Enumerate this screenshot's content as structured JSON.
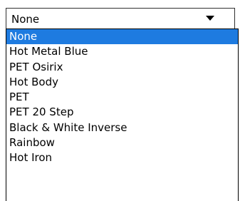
{
  "combo": {
    "selected_value": "None"
  },
  "dropdown": {
    "options": [
      {
        "label": "None",
        "selected": true
      },
      {
        "label": "Hot Metal Blue",
        "selected": false
      },
      {
        "label": "PET Osirix",
        "selected": false
      },
      {
        "label": "Hot Body",
        "selected": false
      },
      {
        "label": "PET",
        "selected": false
      },
      {
        "label": "PET 20 Step",
        "selected": false
      },
      {
        "label": "Black & White Inverse",
        "selected": false
      },
      {
        "label": "Rainbow",
        "selected": false
      },
      {
        "label": "Hot Iron",
        "selected": false
      }
    ]
  },
  "colors": {
    "selection_background": "#1e7be0",
    "selection_text": "#ffffff"
  },
  "icons": {
    "combo_arrow": "chevron-down-icon"
  }
}
